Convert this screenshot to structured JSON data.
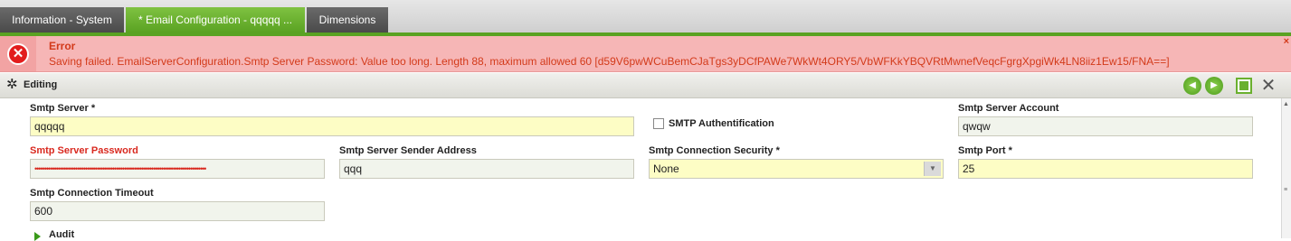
{
  "tabs": [
    {
      "label": "Information - System"
    },
    {
      "label": "* Email Configuration - qqqqq ..."
    },
    {
      "label": "Dimensions"
    }
  ],
  "error": {
    "icon": "error-x-icon",
    "title": "Error",
    "message": "Saving failed. EmailServerConfiguration.Smtp Server Password: Value too long. Length 88, maximum allowed 60 [d59V6pwWCuBemCJaTgs3yDCfPAWe7WkWt4ORY5/VbWFKkYBQVRtMwnefVeqcFgrgXpgiWk4LN8iiz1Ew15/FNA==]",
    "close": "×"
  },
  "editbar": {
    "label": "Editing",
    "icon": "asterisk-icon",
    "prev": "◀",
    "next": "▶",
    "close": "✕"
  },
  "form": {
    "smtp_server": {
      "label": "Smtp Server *",
      "value": "qqqqq"
    },
    "smtp_auth": {
      "label": "SMTP Authentification",
      "checked": false
    },
    "smtp_account": {
      "label": "Smtp Server Account",
      "value": "qwqw"
    },
    "smtp_password": {
      "label": "Smtp Server Password",
      "value": "••••••••••••••••••••••••••••••••••••••••••••••••••••••••••••••••••••••••••••••••••••••••"
    },
    "sender_address": {
      "label": "Smtp Server Sender Address",
      "value": "qqq"
    },
    "connection_security": {
      "label": "Smtp Connection Security *",
      "value": "None"
    },
    "smtp_port": {
      "label": "Smtp Port *",
      "value": "25"
    },
    "connection_timeout": {
      "label": "Smtp Connection Timeout",
      "value": "600"
    },
    "audit": {
      "label": "Audit"
    }
  },
  "colors": {
    "active_tab": "#5aa222",
    "error_bg": "#f6b6b6",
    "error_text": "#d33a1a",
    "required_field": "#fdfdc5"
  }
}
